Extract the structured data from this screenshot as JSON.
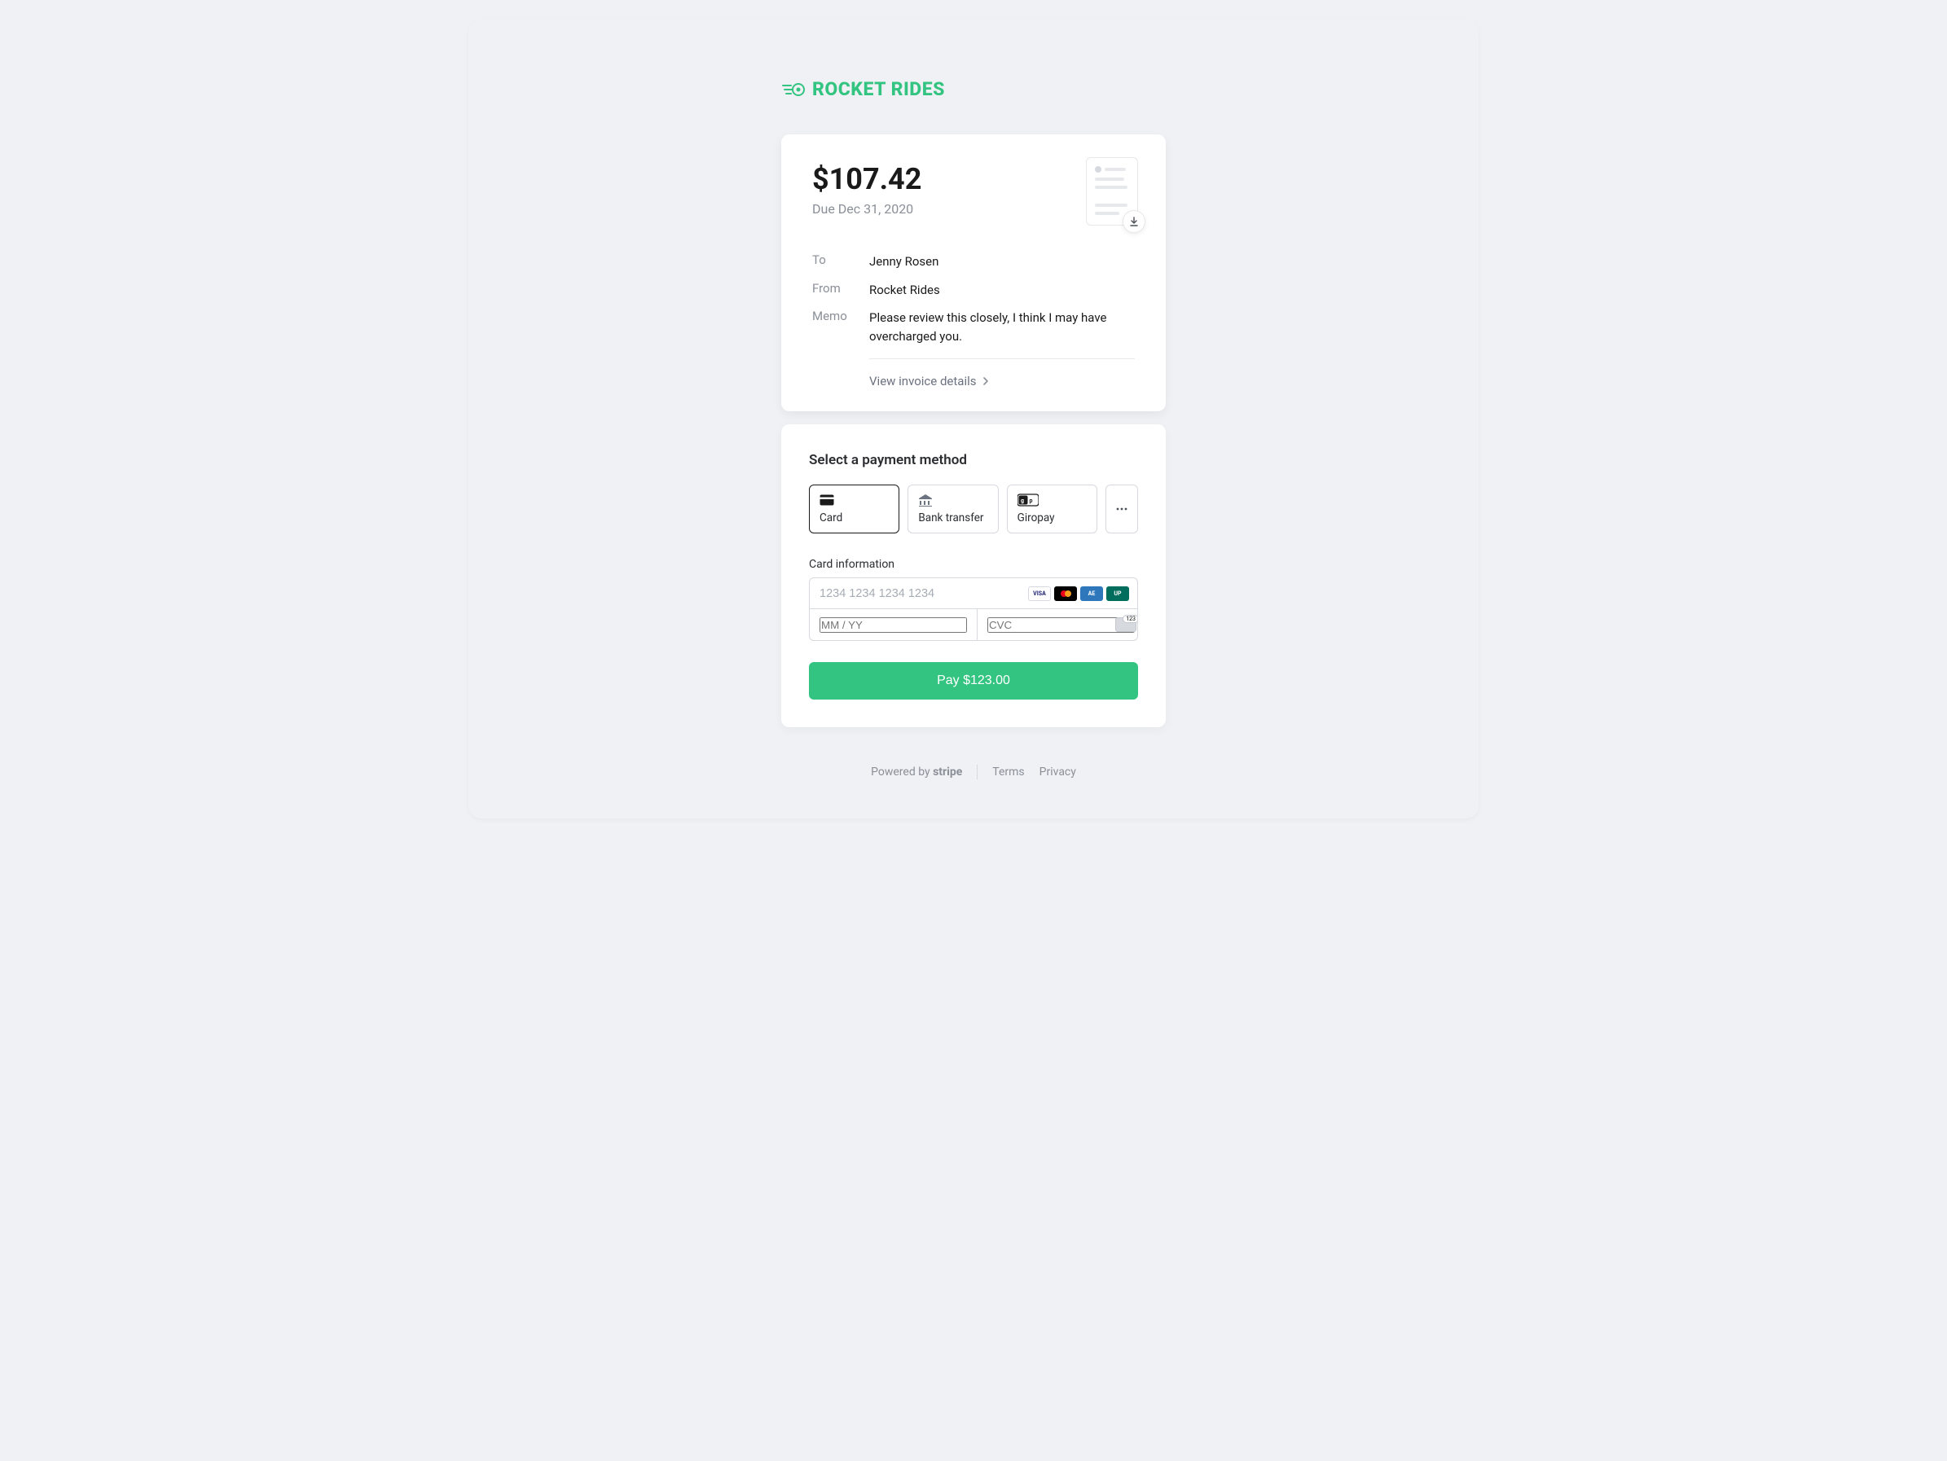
{
  "brand": {
    "name": "ROCKET RIDES",
    "accent": "#33c481"
  },
  "invoice": {
    "amount_display": "$107.42",
    "due_line": "Due Dec 31, 2020",
    "to_label": "To",
    "to_value": "Jenny Rosen",
    "from_label": "From",
    "from_value": "Rocket Rides",
    "memo_label": "Memo",
    "memo_value": "Please review this closely, I think I may have overcharged you.",
    "view_details": "View invoice details"
  },
  "payment": {
    "section_title": "Select a payment method",
    "methods": [
      {
        "key": "card",
        "label": "Card",
        "selected": true
      },
      {
        "key": "bank",
        "label": "Bank transfer",
        "selected": false
      },
      {
        "key": "giropay",
        "label": "Giropay",
        "selected": false
      }
    ],
    "card_info_label": "Card information",
    "card_number_placeholder": "1234 1234 1234 1234",
    "expiry_placeholder": "MM / YY",
    "cvc_placeholder": "CVC",
    "card_brands": [
      "VISA",
      "MC",
      "AMEX",
      "UP"
    ],
    "pay_button": "Pay $123.00"
  },
  "footer": {
    "powered_by": "Powered by",
    "processor": "stripe",
    "terms": "Terms",
    "privacy": "Privacy"
  }
}
